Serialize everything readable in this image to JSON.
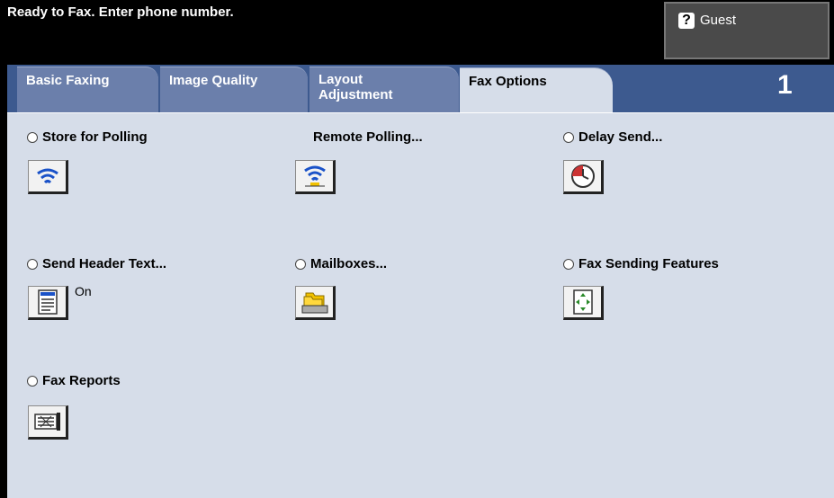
{
  "status_message": "Ready to Fax. Enter phone number.",
  "guest": {
    "icon": "help-icon",
    "label": "Guest"
  },
  "tabs": [
    {
      "label": "Basic Faxing",
      "active": false
    },
    {
      "label": "Image Quality",
      "active": false
    },
    {
      "label": "Layout Adjustment",
      "active": false
    },
    {
      "label": "Fax Options",
      "active": true
    }
  ],
  "page_number": "1",
  "options": [
    {
      "label": "Store for Polling",
      "icon": "polling-icon"
    },
    {
      "label": "Remote Polling...",
      "icon": "remote-polling-icon"
    },
    {
      "label": "Delay Send...",
      "icon": "clock-icon"
    },
    {
      "label": "Send Header Text...",
      "icon": "header-text-icon",
      "state": "On"
    },
    {
      "label": "Mailboxes...",
      "icon": "mailbox-icon"
    },
    {
      "label": "Fax Sending Features",
      "icon": "arrows-icon"
    },
    {
      "label": "Fax Reports",
      "icon": "report-icon"
    }
  ],
  "colors": {
    "tab_bar": "#3d5a8f",
    "tab_inactive": "#6b7fab",
    "panel": "#d6dde9",
    "accent_blue": "#1a52c8"
  }
}
